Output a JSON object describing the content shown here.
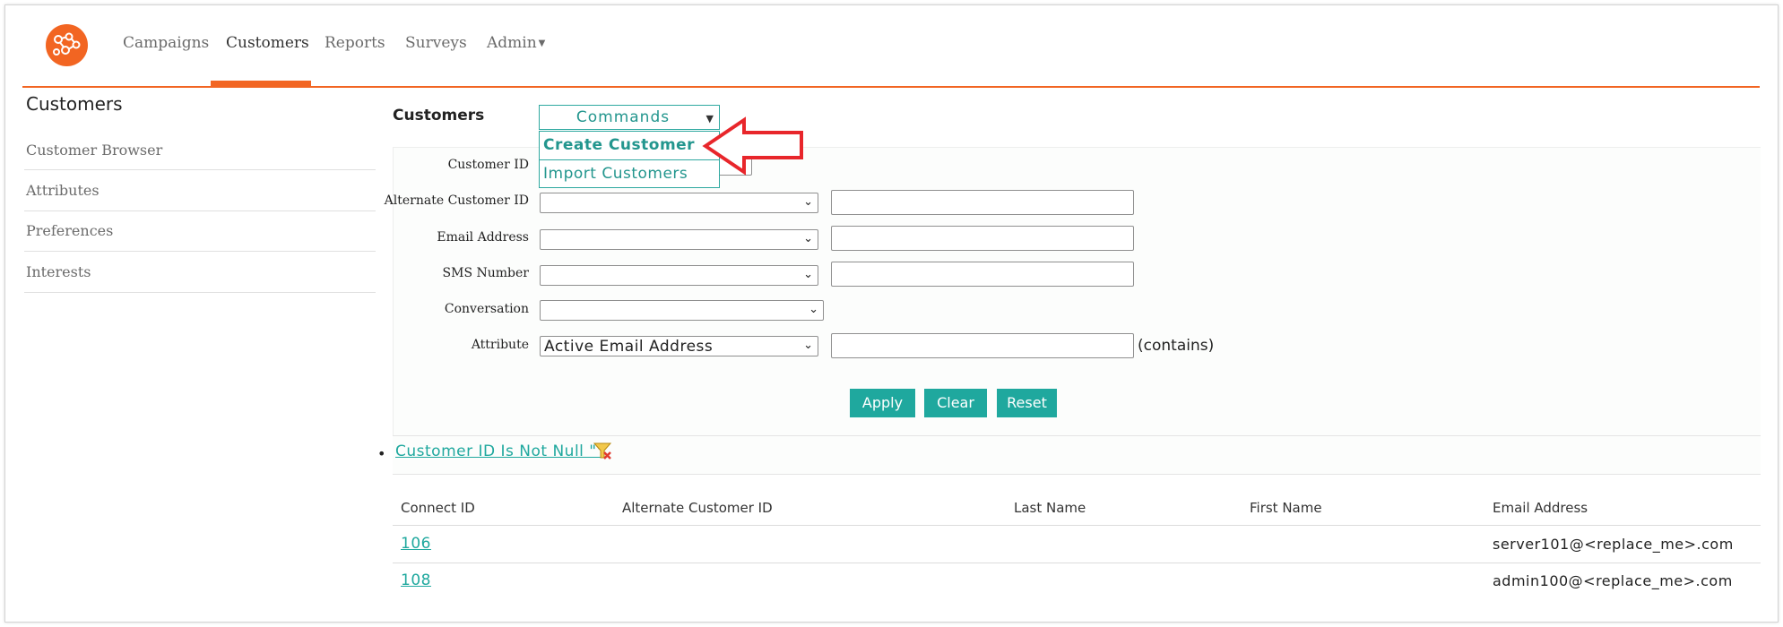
{
  "nav": {
    "items": [
      "Campaigns",
      "Customers",
      "Reports",
      "Surveys",
      "Admin"
    ],
    "active": "Customers",
    "accent_color": "#f26522"
  },
  "sidebar": {
    "title": "Customers",
    "items": [
      "Customer Browser",
      "Attributes",
      "Preferences",
      "Interests"
    ]
  },
  "main": {
    "title": "Customers",
    "commands": {
      "label": "Commands",
      "options": [
        "Create Customer",
        "Import Customers"
      ]
    }
  },
  "form": {
    "fields": [
      {
        "label": "Customer ID",
        "selected": "",
        "value": ""
      },
      {
        "label": "Alternate Customer ID",
        "selected": "",
        "value": ""
      },
      {
        "label": "Email Address",
        "selected": "",
        "value": ""
      },
      {
        "label": "SMS Number",
        "selected": "",
        "value": ""
      },
      {
        "label": "Conversation",
        "selected": ""
      },
      {
        "label": "Attribute",
        "selected": "Active Email Address",
        "value": "",
        "suffix": "(contains)"
      }
    ],
    "buttons": [
      "Apply",
      "Clear",
      "Reset"
    ],
    "button_color": "#1fa89e"
  },
  "filter": {
    "text": "Customer ID Is Not Null \"\"",
    "icon": "remove-filter-icon"
  },
  "table": {
    "columns": [
      "Connect ID",
      "Alternate Customer ID",
      "Last Name",
      "First Name",
      "Email Address"
    ],
    "rows": [
      {
        "id": "106",
        "alt_id": "",
        "last": "",
        "first": "",
        "email": "server101@<replace_me>.com"
      },
      {
        "id": "108",
        "alt_id": "",
        "last": "",
        "first": "",
        "email": "admin100@<replace_me>.com"
      }
    ]
  }
}
